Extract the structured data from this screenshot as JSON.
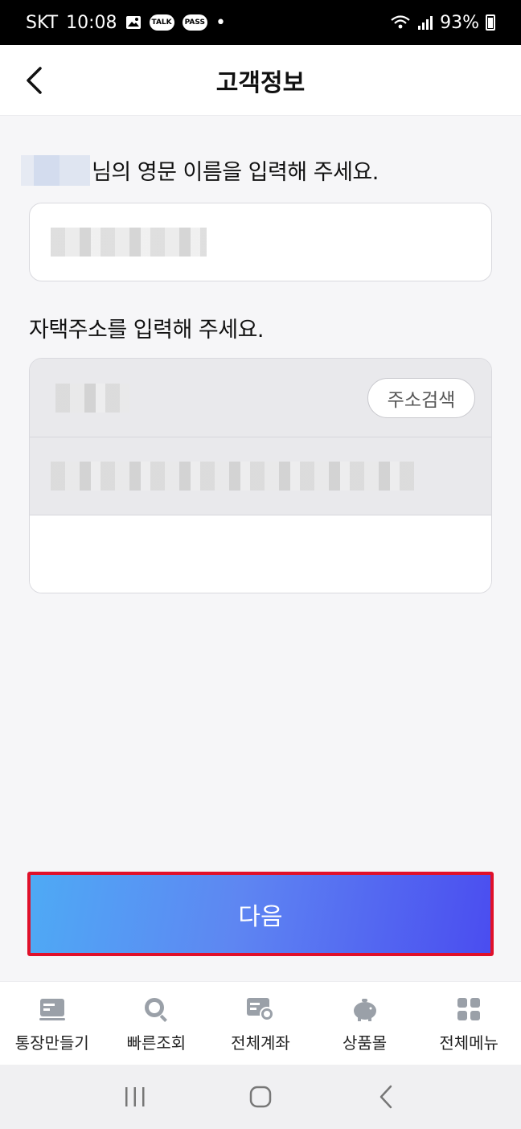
{
  "status_bar": {
    "carrier": "SKT",
    "time": "10:08",
    "talk_badge": "TALK",
    "pass_badge": "PASS",
    "dot": "•",
    "battery": "93%"
  },
  "header": {
    "title": "고객정보"
  },
  "form": {
    "name_prompt": "님의 영문 이름을 입력해 주세요.",
    "address_prompt": "자택주소를 입력해 주세요.",
    "address_search_label": "주소검색"
  },
  "actions": {
    "next_label": "다음"
  },
  "tabbar": {
    "items": [
      {
        "label": "통장만들기",
        "icon": "passbook-icon"
      },
      {
        "label": "빠른조회",
        "icon": "quick-search-icon"
      },
      {
        "label": "전체계좌",
        "icon": "all-accounts-icon"
      },
      {
        "label": "상품몰",
        "icon": "piggy-bank-icon"
      },
      {
        "label": "전체메뉴",
        "icon": "grid-menu-icon"
      }
    ]
  },
  "colors": {
    "button_gradient_start": "#4eaaf5",
    "button_gradient_end": "#4a4df0",
    "highlight_border": "#e0102a"
  }
}
